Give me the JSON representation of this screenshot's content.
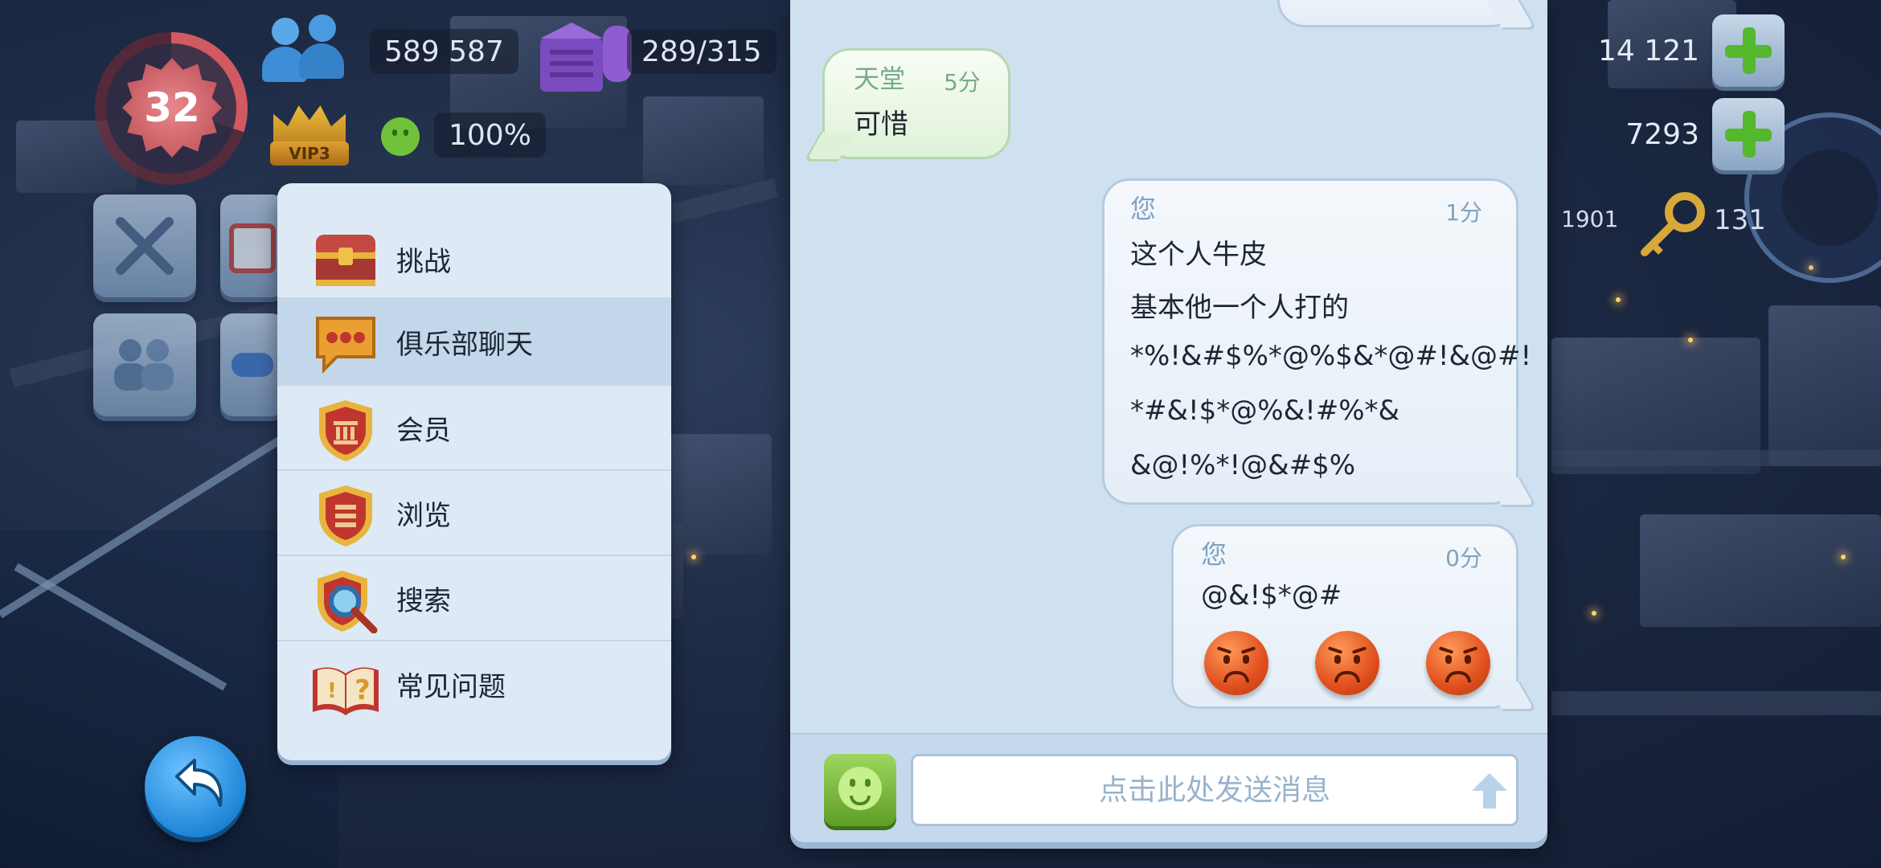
{
  "hud": {
    "level": "32",
    "population": "589 587",
    "storage": "289/315",
    "vip_label": "VIP3",
    "happiness": "100%",
    "simoleons": "14 121",
    "simcash": "7293",
    "keys_left": "1901",
    "keys_right": "131"
  },
  "menu": {
    "items": [
      {
        "label": "挑战",
        "icon": "treasure-chest-icon"
      },
      {
        "label": "俱乐部聊天",
        "icon": "chat-bubble-icon",
        "selected": true
      },
      {
        "label": "会员",
        "icon": "members-shield-icon"
      },
      {
        "label": "浏览",
        "icon": "browse-shield-icon"
      },
      {
        "label": "搜索",
        "icon": "search-magnifier-icon"
      },
      {
        "label": "常见问题",
        "icon": "faq-book-icon"
      }
    ]
  },
  "chat": {
    "messages": [
      {
        "sender": "天堂",
        "time": "5分",
        "lines": [
          "可惜"
        ]
      },
      {
        "sender": "您",
        "time": "1分",
        "lines": [
          "这个人牛皮",
          "基本他一个人打的",
          "*%!&#$%*@%$&*@#!&@#!",
          "*#&!$*@%&!#%*&",
          "&@!%*!@&#$%"
        ]
      },
      {
        "sender": "您",
        "time": "0分",
        "lines": [
          "@&!$*@#"
        ],
        "emojis": [
          "sad-face",
          "sad-face",
          "sad-face"
        ]
      }
    ],
    "input_placeholder": "点击此处发送消息"
  },
  "colors": {
    "panel_bg": "#cfe1f1",
    "menu_bg": "#dde9f5",
    "selected_item": "#c3d7ea",
    "accent_green": "#5e9e24",
    "back_button_blue": "#1f86d8"
  }
}
